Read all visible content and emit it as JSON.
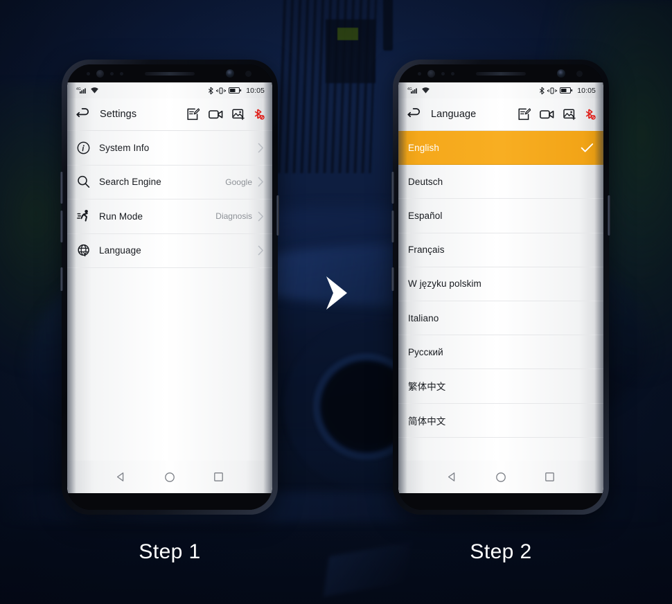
{
  "background": {
    "base_color": "#0b1a38",
    "scene": "dark-navy-automotive-workshop"
  },
  "arrow": {
    "name": "step-arrow",
    "color": "#ffffff"
  },
  "captions": {
    "step1": "Step 1",
    "step2": "Step 2"
  },
  "phone1": {
    "statusbar": {
      "signal": "4G",
      "wifi": "wifi-icon",
      "bluetooth": "bluetooth-icon",
      "vibrate": "vibrate-icon",
      "battery": "battery-icon",
      "time": "10:05"
    },
    "appbar": {
      "back": "back-icon",
      "title": "Settings",
      "actions": [
        "note-icon",
        "video-icon",
        "screenshot-icon",
        "bluetooth-off-icon"
      ]
    },
    "list": [
      {
        "icon": "info-icon",
        "label": "System Info",
        "value": "",
        "chevron": "›"
      },
      {
        "icon": "search-icon",
        "label": "Search Engine",
        "value": "Google",
        "chevron": "›"
      },
      {
        "icon": "run-icon",
        "label": "Run Mode",
        "value": "Diagnosis",
        "chevron": "›"
      },
      {
        "icon": "globe-icon",
        "label": "Language",
        "value": "",
        "chevron": "›"
      }
    ],
    "navbar": [
      "back-nav-icon",
      "home-nav-icon",
      "recents-nav-icon"
    ]
  },
  "phone2": {
    "statusbar": {
      "signal": "4G",
      "wifi": "wifi-icon",
      "bluetooth": "bluetooth-icon",
      "vibrate": "vibrate-icon",
      "battery": "battery-icon",
      "time": "10:05"
    },
    "appbar": {
      "back": "back-icon",
      "title": "Language",
      "actions": [
        "note-icon",
        "video-icon",
        "screenshot-icon",
        "bluetooth-off-icon"
      ]
    },
    "highlight_color": "#f5a81b",
    "languages": [
      {
        "label": "English",
        "selected": true,
        "check": "✓"
      },
      {
        "label": "Deutsch",
        "selected": false,
        "check": ""
      },
      {
        "label": "Español",
        "selected": false,
        "check": ""
      },
      {
        "label": "Français",
        "selected": false,
        "check": ""
      },
      {
        "label": "W języku polskim",
        "selected": false,
        "check": ""
      },
      {
        "label": "Italiano",
        "selected": false,
        "check": ""
      },
      {
        "label": "Русский",
        "selected": false,
        "check": ""
      },
      {
        "label": "繁体中文",
        "selected": false,
        "check": ""
      },
      {
        "label": "简体中文",
        "selected": false,
        "check": ""
      }
    ],
    "navbar": [
      "back-nav-icon",
      "home-nav-icon",
      "recents-nav-icon"
    ]
  }
}
